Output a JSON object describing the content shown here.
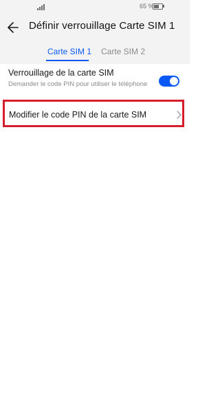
{
  "status_bar": {
    "battery_text": "65 %",
    "battery_level": 0.65,
    "icons": [
      "signal-icon",
      "battery-icon"
    ]
  },
  "header": {
    "title": "Définir verrouillage Carte SIM 1",
    "back_icon": "back-arrow-icon"
  },
  "tabs": [
    {
      "label": "Carte SIM 1",
      "active": true
    },
    {
      "label": "Carte SIM 2",
      "active": false
    }
  ],
  "settings": {
    "sim_lock": {
      "title": "Verrouillage de la carte SIM",
      "subtitle": "Demander le code PIN pour utiliser le téléphone",
      "enabled": true
    },
    "change_pin": {
      "label": "Modifier le code PIN de la carte SIM"
    }
  },
  "colors": {
    "accent": "#0a59f7",
    "highlight_border": "#d51d2b",
    "header_bg": "#f3f3f3"
  }
}
